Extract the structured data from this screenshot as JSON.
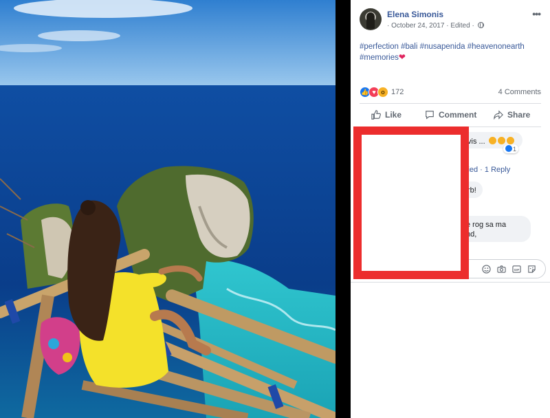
{
  "post": {
    "author": "Elena Simonis",
    "date": "October 24, 2017",
    "edited": "Edited",
    "separator": "·",
    "more": "•••",
    "hashtags": [
      "#perfection",
      "#bali",
      "#nusapenida",
      "#heavenonearth",
      "#memories"
    ],
    "heart": "❤"
  },
  "reactions": {
    "icons": [
      "like-icon",
      "love-icon",
      "wow-icon"
    ],
    "count": "172",
    "comments_count": "4 Comments"
  },
  "actions": {
    "like": "Like",
    "comment": "Comment",
    "share": "Share"
  },
  "comments": {
    "c1_text": "vis ...",
    "c1_likes": "1",
    "c1_replies": "lied · 1 Reply",
    "c2_text": "rb!",
    "c3_line1": "e rog sa ma",
    "c3_line2": "nd,"
  },
  "colors": {
    "link": "#385898",
    "redaction": "#ec2d2d",
    "panel_bg": "#ffffff"
  }
}
